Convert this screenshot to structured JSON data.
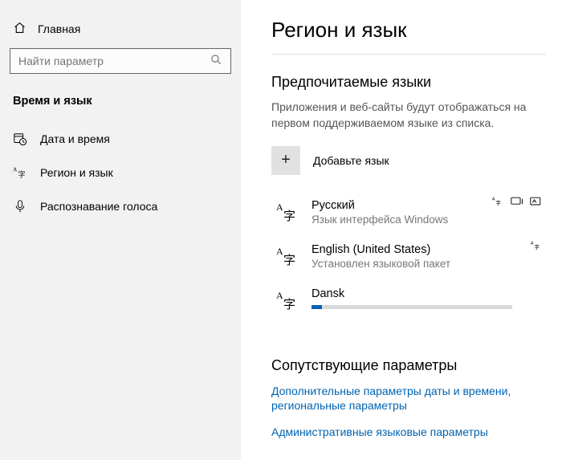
{
  "sidebar": {
    "home_label": "Главная",
    "search_placeholder": "Найти параметр",
    "heading": "Время и язык",
    "items": [
      {
        "label": "Дата и время"
      },
      {
        "label": "Регион и язык"
      },
      {
        "label": "Распознавание голоса"
      }
    ]
  },
  "main": {
    "title": "Регион и язык",
    "preferred_section_title": "Предпочитаемые языки",
    "preferred_section_desc": "Приложения и веб-сайты будут отображаться на первом поддерживаемом языке из списка.",
    "add_language_label": "Добавьте язык",
    "languages": [
      {
        "name": "Русский",
        "sub": "Язык интерфейса Windows"
      },
      {
        "name": "English (United States)",
        "sub": "Установлен языковой пакет"
      },
      {
        "name": "Dansk"
      }
    ],
    "related_title": "Сопутствующие параметры",
    "related_links": [
      "Дополнительные параметры даты и времени, региональные параметры",
      "Административные языковые параметры"
    ]
  }
}
